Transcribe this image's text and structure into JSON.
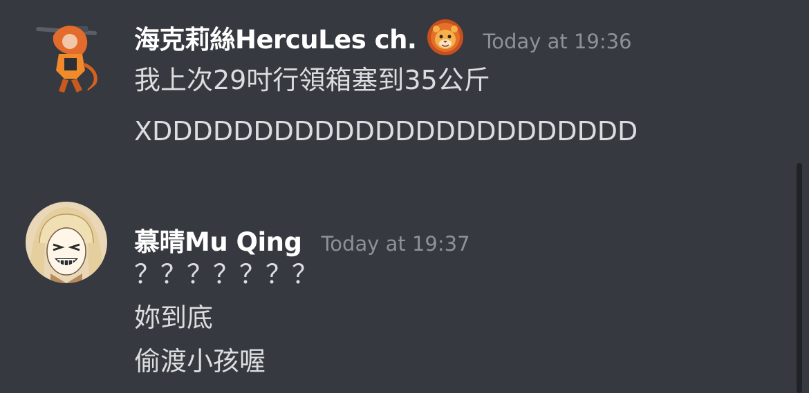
{
  "messages": [
    {
      "username": "海克莉絲HercuLes ch.",
      "badge_icon": "lion-emoji-icon",
      "timestamp": "Today at 19:36",
      "lines": [
        "我上次29吋行領箱塞到35公斤",
        "XDDDDDDDDDDDDDDDDDDDDDDDD"
      ]
    },
    {
      "username": "慕晴Mu Qing",
      "timestamp": "Today at 19:37",
      "lines": [
        "？？？？？？？",
        "妳到底",
        "偷渡小孩喔"
      ]
    }
  ],
  "colors": {
    "background": "#36393f",
    "username": "#ffffff",
    "timestamp": "#8e9297",
    "message_text": "#dcddde",
    "scrollbar_thumb": "#202225"
  }
}
